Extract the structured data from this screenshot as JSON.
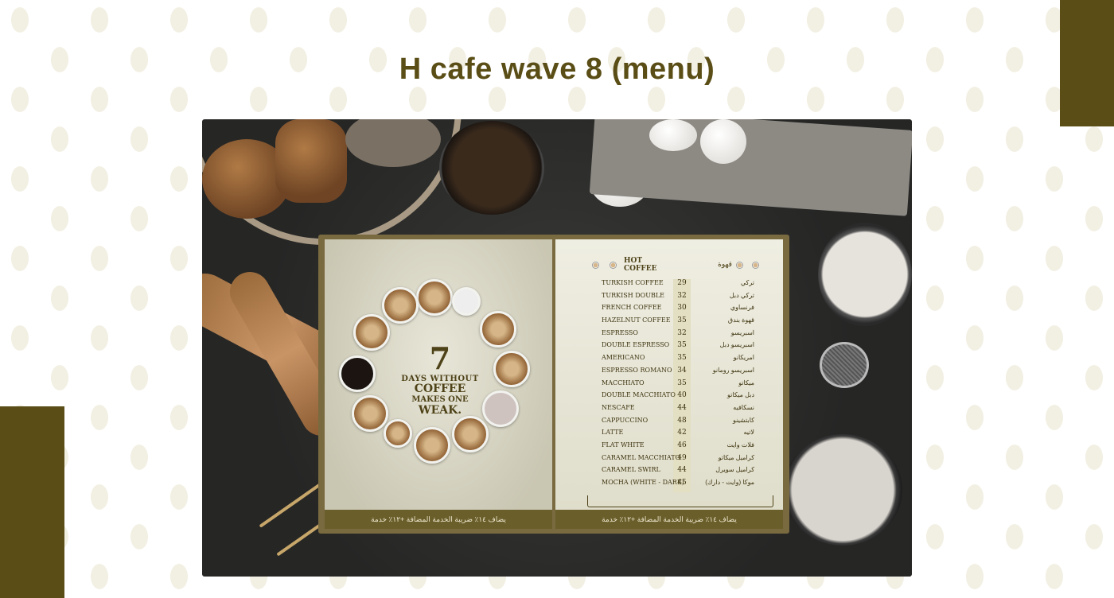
{
  "title": "H cafe wave 8 (menu)",
  "colors": {
    "accent": "#5a4e16",
    "background": "#ffffff"
  },
  "left_page": {
    "quote_number": "7",
    "quote_line1": "DAYS WITHOUT",
    "quote_line2": "COFFEE",
    "quote_line3": "MAKES ONE",
    "quote_line4": "WEAK.",
    "footer": "يضاف ١٤٪ ضريبة الخدمة المضافة +١٢٪ خدمة"
  },
  "right_page": {
    "heading_en_1": "HOT",
    "heading_en_2": "COFFEE",
    "heading_ar": "قهوة",
    "footer": "يضاف ١٤٪ ضريبة الخدمة المضافة +١٢٪ خدمة",
    "items": [
      {
        "en": "TURKISH COFFEE",
        "price": "29",
        "ar": "تركي"
      },
      {
        "en": "TURKISH DOUBLE",
        "price": "32",
        "ar": "تركي دبل"
      },
      {
        "en": "FRENCH COFFEE",
        "price": "30",
        "ar": "فرنساوي"
      },
      {
        "en": "HAZELNUT COFFEE",
        "price": "35",
        "ar": "قهوة بندق"
      },
      {
        "en": "ESPRESSO",
        "price": "32",
        "ar": "اسبريسو"
      },
      {
        "en": "DOUBLE ESPRESSO",
        "price": "35",
        "ar": "اسبريسو دبل"
      },
      {
        "en": "AMERICANO",
        "price": "35",
        "ar": "امريكانو"
      },
      {
        "en": "ESPRESSO ROMANO",
        "price": "34",
        "ar": "اسبريسو رومانو"
      },
      {
        "en": "MACCHIATO",
        "price": "35",
        "ar": "ميكاتو"
      },
      {
        "en": "DOUBLE MACCHIATO",
        "price": "40",
        "ar": "دبل ميكاتو"
      },
      {
        "en": "NESCAFE",
        "price": "44",
        "ar": "نسكافيه"
      },
      {
        "en": "CAPPUCCINO",
        "price": "48",
        "ar": "كابتشينو"
      },
      {
        "en": "LATTE",
        "price": "42",
        "ar": "لاتيه"
      },
      {
        "en": "FLAT WHITE",
        "price": "46",
        "ar": "فلات وايت"
      },
      {
        "en": "CARAMEL MACCHIATO",
        "price": "49",
        "ar": "كراميل ميكاتو"
      },
      {
        "en": "CARAMEL SWIRL",
        "price": "44",
        "ar": "كراميل سويرل"
      },
      {
        "en": "MOCHA (WHITE - DARK)",
        "price": "45",
        "ar": "موكا (وايت - دارك)"
      }
    ]
  }
}
